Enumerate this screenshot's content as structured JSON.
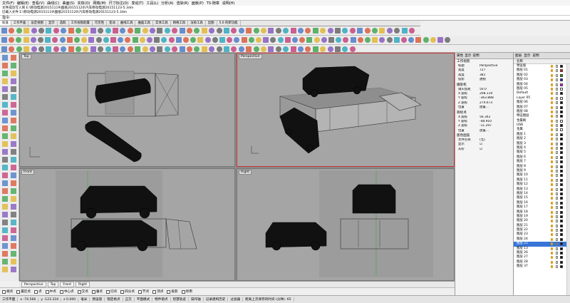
{
  "menu": [
    "文件(F)",
    "编辑(E)",
    "查看(V)",
    "曲线(C)",
    "曲面(S)",
    "实体(O)",
    "网格(M)",
    "尺寸标注(D)",
    "变动(T)",
    "工具(L)",
    "分析(A)",
    "渲染(R)",
    "面板(P)",
    "TS-随章",
    "说明(H)"
  ],
  "command_history": [
    "文件成功写入到 E:\\移动电源20151119\\图纸20151120\\汽车移动电源20151123-5.3dm",
    "已载入文件 E:\\移动电源20151119\\图纸20151120\\汽车移动电源20151123-5.3dm",
    "",
    "",
    ""
  ],
  "command_prompt": "指令:",
  "toolbar_tabs": [
    {
      "label": "标准",
      "active": true
    },
    {
      "label": "工作平面"
    },
    {
      "label": "设定视图"
    },
    {
      "label": "显示"
    },
    {
      "label": "选取"
    },
    {
      "label": "工作视窗配置"
    },
    {
      "label": "可见性"
    },
    {
      "label": "变动"
    },
    {
      "label": "曲线工具"
    },
    {
      "label": "曲面工具"
    },
    {
      "label": "实体工具"
    },
    {
      "label": "网格工具"
    },
    {
      "label": "渲染工具"
    },
    {
      "label": "出图"
    },
    {
      "label": "5.0 的新功能"
    }
  ],
  "viewports": {
    "top": {
      "label": "Top"
    },
    "perspective": {
      "label": "Perspective"
    },
    "front": {
      "label": "Front"
    },
    "right": {
      "label": "Right"
    }
  },
  "viewport_tabs": [
    "Perspective",
    "Top",
    "Front",
    "Right"
  ],
  "osnaps": [
    "端点",
    "最近点",
    "点",
    "中点",
    "中心点",
    "交点",
    "垂点",
    "切点",
    "四分点",
    "节点",
    "顶点",
    "投影",
    "停用"
  ],
  "status": {
    "plane": "工作平面",
    "x": "x -74.566",
    "y": "y -123.334",
    "z": "z 0.000",
    "unit": "毫米",
    "layer": "预设值",
    "items": [
      "锁定格点",
      "正交",
      "平面模式",
      "物件锁点",
      "智慧轨迹",
      "操作轴",
      "记录建构历史",
      "过滤器",
      "距离上次保存的时间 (分钟): 65"
    ]
  },
  "props": {
    "tabs": [
      "属性",
      "显示",
      "说明"
    ],
    "section_view": "工作视窗",
    "rows_view": [
      {
        "k": "标题",
        "v": "Perspective"
      },
      {
        "k": "宽度",
        "v": "727"
      },
      {
        "k": "高度",
        "v": "381"
      },
      {
        "k": "投影",
        "v": "透视"
      }
    ],
    "section_cam": "摄影机",
    "rows_cam": [
      {
        "k": "镜头焦距",
        "v": "50.0"
      },
      {
        "k": "X 座标",
        "v": "208.119"
      },
      {
        "k": "Y 座标",
        "v": "-363.888"
      },
      {
        "k": "Z 座标",
        "v": "274.673"
      },
      {
        "k": "位置",
        "v": "放置..."
      }
    ],
    "section_target": "目标点",
    "rows_target": [
      {
        "k": "X 座标",
        "v": "56.342"
      },
      {
        "k": "Y 座标",
        "v": "-48.910"
      },
      {
        "k": "Z 座标",
        "v": "-11.297"
      },
      {
        "k": "位置",
        "v": "放置..."
      }
    ],
    "section_bg": "底色图案",
    "rows_bg": [
      {
        "k": "文件名称",
        "v": "(无)"
      },
      {
        "k": "显示",
        "v": "☑"
      },
      {
        "k": "灰阶",
        "v": "☑"
      }
    ]
  },
  "layers": {
    "tabs": [
      "图层",
      "显示",
      "说明"
    ],
    "header": "名称",
    "items": [
      {
        "name": "预设值",
        "color": "#000000"
      },
      {
        "name": "图层 01",
        "color": "#ff0000"
      },
      {
        "name": "图层 02",
        "color": "#00a000"
      },
      {
        "name": "图层 03",
        "color": "#2020ff"
      },
      {
        "name": "图层 04",
        "color": "#ff00ff"
      },
      {
        "name": "图层 05",
        "color": "#ffffff"
      },
      {
        "name": "Default",
        "color": "#000000"
      },
      {
        "name": "Layer 05",
        "color": "#ffffff"
      },
      {
        "name": "图层 06",
        "color": "#000000"
      },
      {
        "name": "图层 07",
        "color": "#000000"
      },
      {
        "name": "图层 08",
        "color": "#000000"
      },
      {
        "name": "特征图层",
        "color": "#000000"
      },
      {
        "name": "金属网",
        "color": "#ffffff"
      },
      {
        "name": "USB",
        "color": "#000000"
      },
      {
        "name": "金属",
        "color": "#ffffff"
      },
      {
        "name": "图层 1",
        "color": "#000000"
      },
      {
        "name": "图层 2",
        "color": "#000000"
      },
      {
        "name": "图层 3",
        "color": "#000000"
      },
      {
        "name": "图层 4",
        "color": "#000000"
      },
      {
        "name": "图层 5",
        "color": "#000000"
      },
      {
        "name": "图层 6",
        "color": "#000000"
      },
      {
        "name": "图层 7",
        "color": "#000000"
      },
      {
        "name": "图层 8",
        "color": "#000000"
      },
      {
        "name": "图层 9",
        "color": "#000000"
      },
      {
        "name": "图层 10",
        "color": "#000000"
      },
      {
        "name": "图层 11",
        "color": "#000000"
      },
      {
        "name": "图层 12",
        "color": "#000000"
      },
      {
        "name": "图层 13",
        "color": "#000000"
      },
      {
        "name": "图层 14",
        "color": "#000000"
      },
      {
        "name": "图层 15",
        "color": "#000000"
      },
      {
        "name": "图层 16",
        "color": "#000000"
      },
      {
        "name": "图层 17",
        "color": "#000000"
      },
      {
        "name": "图层 18",
        "color": "#000000"
      },
      {
        "name": "图层 19",
        "color": "#000000"
      },
      {
        "name": "图层 20",
        "color": "#000000"
      },
      {
        "name": "图层 21",
        "color": "#000000"
      },
      {
        "name": "图层 22",
        "color": "#000000"
      },
      {
        "name": "图层 23",
        "color": "#000000"
      },
      {
        "name": "图层 24",
        "color": "#000000"
      },
      {
        "name": "图层 25",
        "color": "#000000",
        "selected": true
      },
      {
        "name": "图层 13",
        "color": "#000000"
      },
      {
        "name": "图层 26",
        "color": "#000000"
      },
      {
        "name": "图层 27",
        "color": "#000000"
      },
      {
        "name": "图层 28",
        "color": "#000000"
      },
      {
        "name": "图层 37",
        "color": "#000000"
      }
    ]
  }
}
